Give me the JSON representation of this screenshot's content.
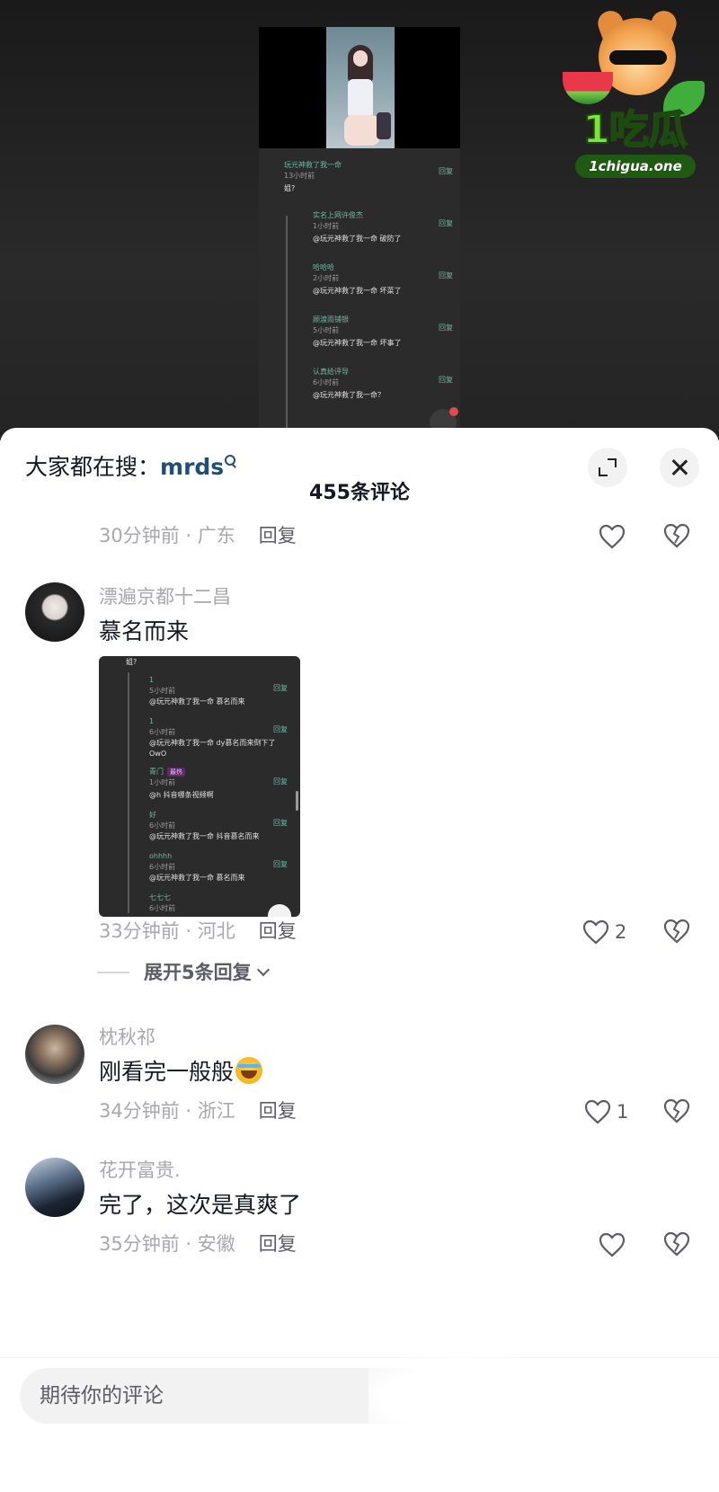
{
  "video_screenshot": {
    "comments": [
      {
        "name": "玩元神救了我一命",
        "time": "13小时前",
        "text": "姐?",
        "reply": "回复"
      },
      {
        "name": "实名上网许俊杰",
        "time": "1小时前",
        "text": "@玩元神救了我一命 破防了",
        "reply": "回复"
      },
      {
        "name": "哈哈哈",
        "time": "2小时前",
        "text": "@玩元神救了我一命 坏菜了",
        "reply": "回复"
      },
      {
        "name": "顾渡雨铺银",
        "time": "5小时前",
        "text": "@玩元神救了我一命 坏事了",
        "reply": "回复"
      },
      {
        "name": "认真给评导",
        "time": "6小时前",
        "text": "@玩元神救了我一命？",
        "reply": "回复"
      }
    ]
  },
  "watermark": {
    "brand": "1吃瓜",
    "url": "1chigua.one"
  },
  "sheet": {
    "search_prefix": "大家都在搜：",
    "search_keyword": "mrds",
    "comment_count_title": "455条评论",
    "input_placeholder": "期待你的评论"
  },
  "comments": [
    {
      "meta": "30分钟前 · 广东",
      "reply": "回复",
      "likes": ""
    },
    {
      "username": "漂遍京都十二昌",
      "text": "慕名而来",
      "meta": "33分钟前 · 河北",
      "reply": "回复",
      "likes": "2",
      "expand_label": "展开5条回复",
      "image_rows": [
        {
          "a": "姐?"
        },
        {
          "name": "1",
          "time": "5小时前",
          "text": "@玩元神救了我一命 慕名而来",
          "reply": "回复"
        },
        {
          "name": "1",
          "time": "6小时前",
          "text": "@玩元神救了我一命 dy慕名而来倒下了",
          "text2": "OwO",
          "reply": "回复"
        },
        {
          "name": "青门",
          "tag": "最热",
          "time": "1小时前",
          "text": "@h 抖音哪条视频啊",
          "reply": "回复"
        },
        {
          "name": "好",
          "time": "6小时前",
          "text": "@玩元神救了我一命 抖音慕名而来",
          "reply": "回复"
        },
        {
          "name": "ohhhh",
          "time": "6小时前",
          "text": "@玩元神救了我一命 慕名而来",
          "reply": "回复"
        },
        {
          "name": "七七七",
          "time": "6小时前"
        }
      ]
    },
    {
      "username": "枕秋祁",
      "text": "刚看完一般般",
      "meta": "34分钟前 · 浙江",
      "reply": "回复",
      "likes": "1"
    },
    {
      "username": "花开富贵.",
      "text": "完了，这次是真爽了",
      "meta": "35分钟前 · 安徽",
      "reply": "回复",
      "likes": ""
    }
  ]
}
